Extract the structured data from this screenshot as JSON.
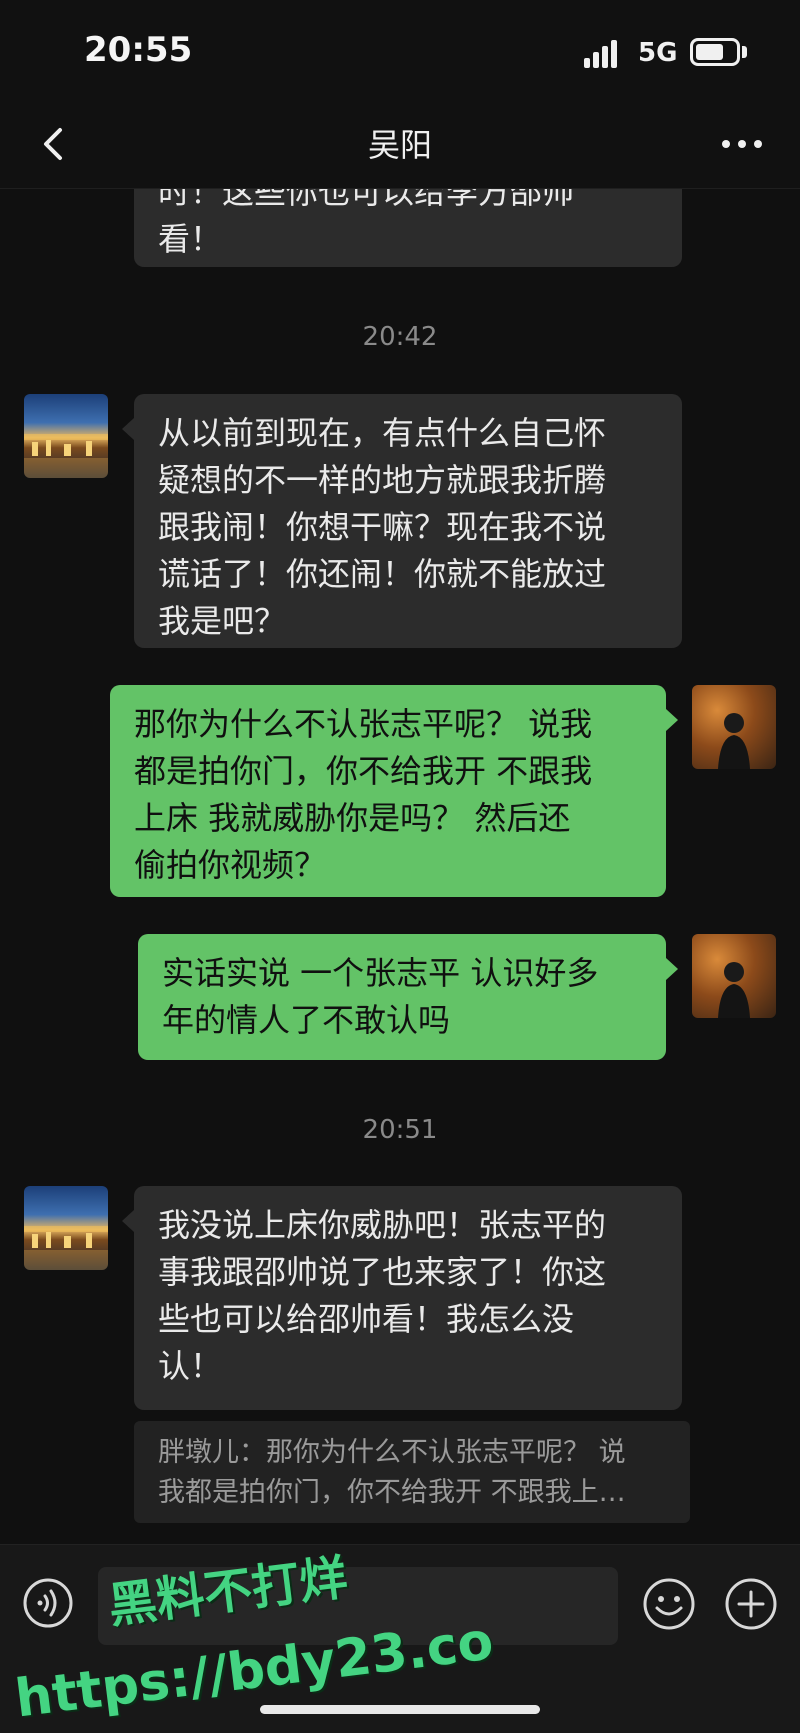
{
  "status_bar": {
    "time": "20:55",
    "network": "5G",
    "battery_level": 0.7
  },
  "nav": {
    "title": "吴阳",
    "back_icon": "chevron-left-icon",
    "more_icon": "more-dots-icon"
  },
  "messages": {
    "m0": {
      "lines": [
        "时！这些你也可以给李方邵帅",
        "看！"
      ]
    },
    "t1": "20:42",
    "m1": {
      "lines": [
        "从以前到现在，有点什么自己怀",
        "疑想的不一样的地方就跟我折腾",
        "跟我闹！你想干嘛？现在我不说",
        "谎话了！你还闹！你就不能放过",
        "我是吧？"
      ]
    },
    "m2": {
      "lines": [
        "那你为什么不认张志平呢？ 说我",
        "都是拍你门，你不给我开 不跟我",
        "上床 我就威胁你是吗？ 然后还",
        "偷拍你视频？"
      ]
    },
    "m3": {
      "lines": [
        "实话实说 一个张志平 认识好多",
        "年的情人了不敢认吗"
      ]
    },
    "t2": "20:51",
    "m4": {
      "lines": [
        "我没说上床你威胁吧！张志平的",
        "事我跟邵帅说了也来家了！你这",
        "些也可以给邵帅看！我怎么没",
        "认！"
      ]
    },
    "quote": {
      "lines": [
        "胖墩儿：那你为什么不认张志平呢？ 说",
        "我都是拍你门，你不给我开 不跟我上…"
      ]
    }
  },
  "input_bar": {
    "placeholder": "",
    "voice_icon": "voice-icon",
    "emoji_icon": "emoji-icon",
    "plus_icon": "plus-icon"
  },
  "watermark": {
    "line1": "黑料不打烊",
    "line2": "https://bdy23.co"
  },
  "colors": {
    "background": "#101010",
    "received_bubble": "#2c2c2c",
    "sent_bubble": "#63c367",
    "watermark": "#44d482"
  }
}
